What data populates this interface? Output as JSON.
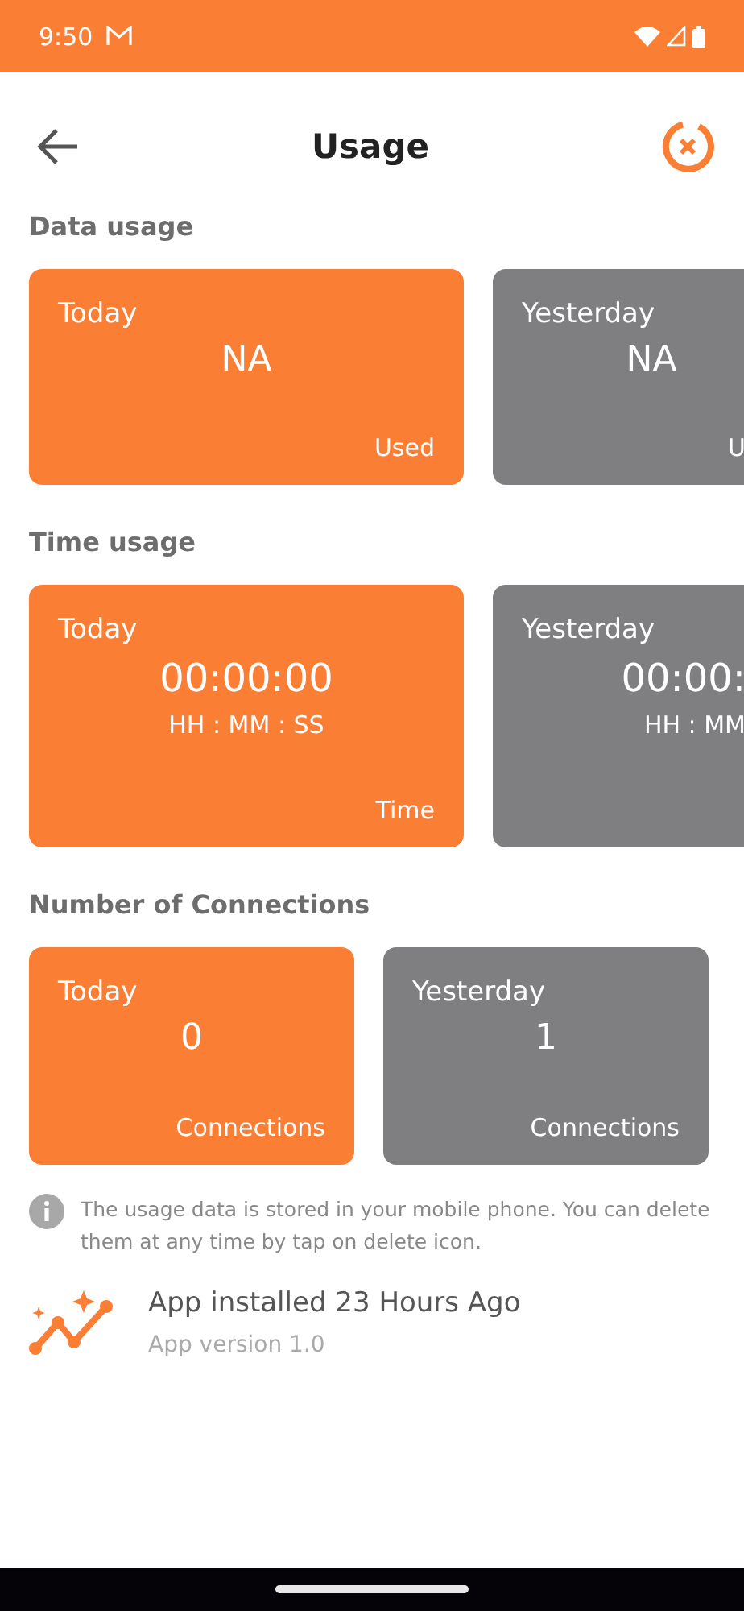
{
  "status_bar": {
    "time": "9:50"
  },
  "header": {
    "title": "Usage"
  },
  "sections": [
    {
      "title": "Data usage",
      "kind": "data",
      "cards": [
        {
          "label": "Today",
          "value": "NA",
          "unit": "Used",
          "selected": true
        },
        {
          "label": "Yesterday",
          "value": "NA",
          "unit": "U",
          "selected": false
        }
      ]
    },
    {
      "title": "Time usage",
      "kind": "time",
      "cards": [
        {
          "label": "Today",
          "value": "00:00:00",
          "format": "HH : MM : SS",
          "unit": "Time",
          "selected": true
        },
        {
          "label": "Yesterday",
          "value": "00:00:",
          "format": "HH : MM",
          "selected": false
        }
      ]
    },
    {
      "title": "Number of Connections",
      "kind": "count",
      "cards": [
        {
          "label": "Today",
          "value": "0",
          "unit": "Connections",
          "selected": true
        },
        {
          "label": "Yesterday",
          "value": "1",
          "unit": "Connections",
          "selected": false
        }
      ]
    }
  ],
  "info": "The usage data is stored in your mobile phone. You can delete them at any time by tap on delete icon.",
  "install": {
    "title": "App installed 23 Hours Ago",
    "version": "App version 1.0"
  }
}
